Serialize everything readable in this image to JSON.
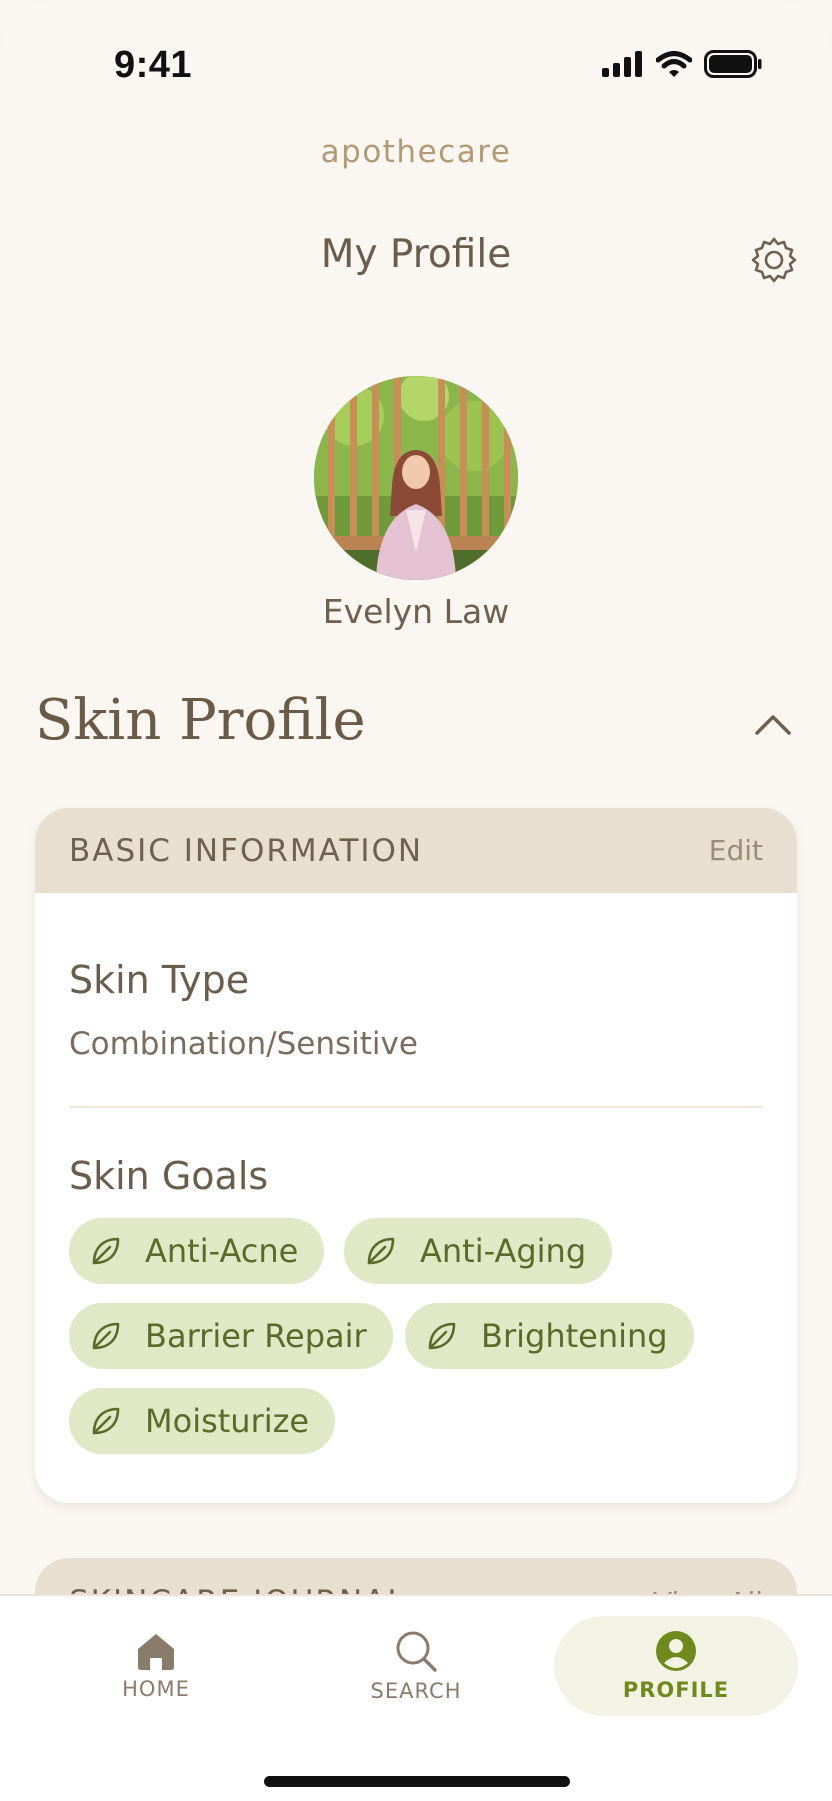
{
  "status_bar": {
    "time": "9:41"
  },
  "brand": "apothecare",
  "header": {
    "title": "My Profile"
  },
  "user": {
    "name": "Evelyn Law"
  },
  "skin_profile": {
    "title": "Skin Profile",
    "basic_info": {
      "heading": "BASIC INFORMATION",
      "edit_label": "Edit",
      "skin_type_label": "Skin Type",
      "skin_type_value": "Combination/Sensitive",
      "skin_goals_label": "Skin Goals",
      "goals": [
        "Anti-Acne",
        "Anti-Aging",
        "Barrier Repair",
        "Brightening",
        "Moisturize"
      ]
    }
  },
  "journal": {
    "heading": "SKINCARE JOURNAL",
    "link": "View All"
  },
  "tabbar": {
    "items": [
      {
        "label": "HOME",
        "icon": "home-icon"
      },
      {
        "label": "SEARCH",
        "icon": "search-icon"
      },
      {
        "label": "PROFILE",
        "icon": "profile-icon",
        "active": true
      }
    ]
  },
  "colors": {
    "accent": "#6f8a1c",
    "chip_bg": "#e0e8c6",
    "card_header": "#e9dfd0",
    "background": "#faf6f1"
  }
}
